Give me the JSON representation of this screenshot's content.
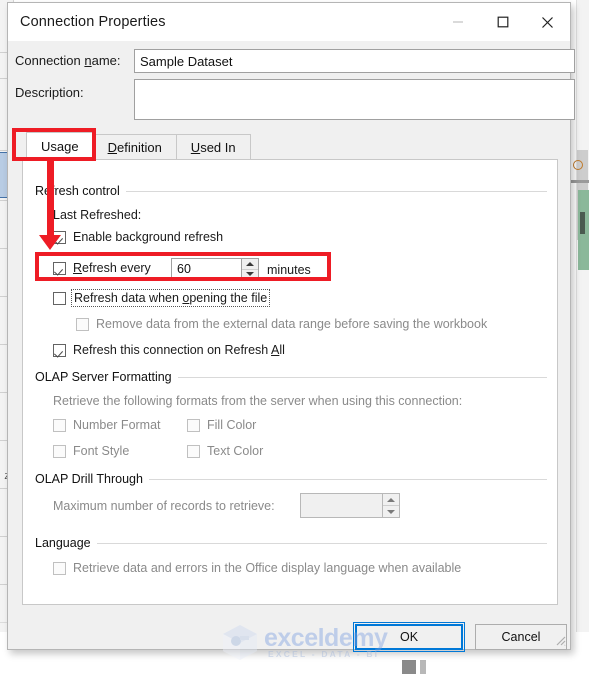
{
  "window": {
    "title": "Connection Properties",
    "controls": [
      {
        "name": "minimize",
        "glyph": "minimize-icon"
      },
      {
        "name": "maximize",
        "glyph": "maximize-icon"
      },
      {
        "name": "close",
        "glyph": "close-icon"
      }
    ]
  },
  "fields": {
    "connection_name_label": "Connection name:",
    "connection_name_value": "Sample Dataset",
    "description_label": "Description:",
    "description_value": ""
  },
  "tabs": [
    {
      "label": "Usage",
      "active": true
    },
    {
      "label": "Definition",
      "active": false
    },
    {
      "label": "Used In",
      "active": false
    }
  ],
  "refresh_control": {
    "group_title": "Refresh control",
    "last_refreshed_label": "Last Refreshed:",
    "enable_background_refresh": {
      "label": "Enable background refresh",
      "checked": true,
      "enabled": true
    },
    "refresh_every": {
      "label": "Refresh every",
      "checked": true,
      "enabled": true,
      "value": "60",
      "unit_label": "minutes"
    },
    "refresh_on_open": {
      "label": "Refresh data when opening the file",
      "checked": false,
      "enabled": true,
      "focused": true
    },
    "remove_data": {
      "label": "Remove data from the external data range before saving the workbook",
      "checked": false,
      "enabled": false
    },
    "refresh_on_refresh_all": {
      "label": "Refresh this connection on Refresh All",
      "checked": true,
      "enabled": true
    }
  },
  "olap_server_formatting": {
    "group_title": "OLAP Server Formatting",
    "description": "Retrieve the following formats from the server when using this connection:",
    "options": [
      {
        "label": "Number Format",
        "checked": false,
        "enabled": false
      },
      {
        "label": "Fill Color",
        "checked": false,
        "enabled": false
      },
      {
        "label": "Font Style",
        "checked": false,
        "enabled": false
      },
      {
        "label": "Text Color",
        "checked": false,
        "enabled": false
      }
    ]
  },
  "olap_drill_through": {
    "group_title": "OLAP Drill Through",
    "max_records_label": "Maximum number of records to retrieve:",
    "max_records_value": "",
    "enabled": false
  },
  "language": {
    "group_title": "Language",
    "option": {
      "label": "Retrieve data and errors in the Office display language when available",
      "checked": false,
      "enabled": false
    }
  },
  "footer": {
    "ok_label": "OK",
    "cancel_label": "Cancel",
    "ok_focused": true
  },
  "watermark": {
    "brand": "exceldemy",
    "tagline": "EXCEL - DATA - BI"
  },
  "annotations": {
    "accent_color": "#ee1c25",
    "highlight_tab": "Usage",
    "highlight_row": "Refresh every",
    "arrow": "points from Usage tab down to Refresh every row"
  },
  "background": {
    "row_labels": [
      "Z"
    ]
  }
}
